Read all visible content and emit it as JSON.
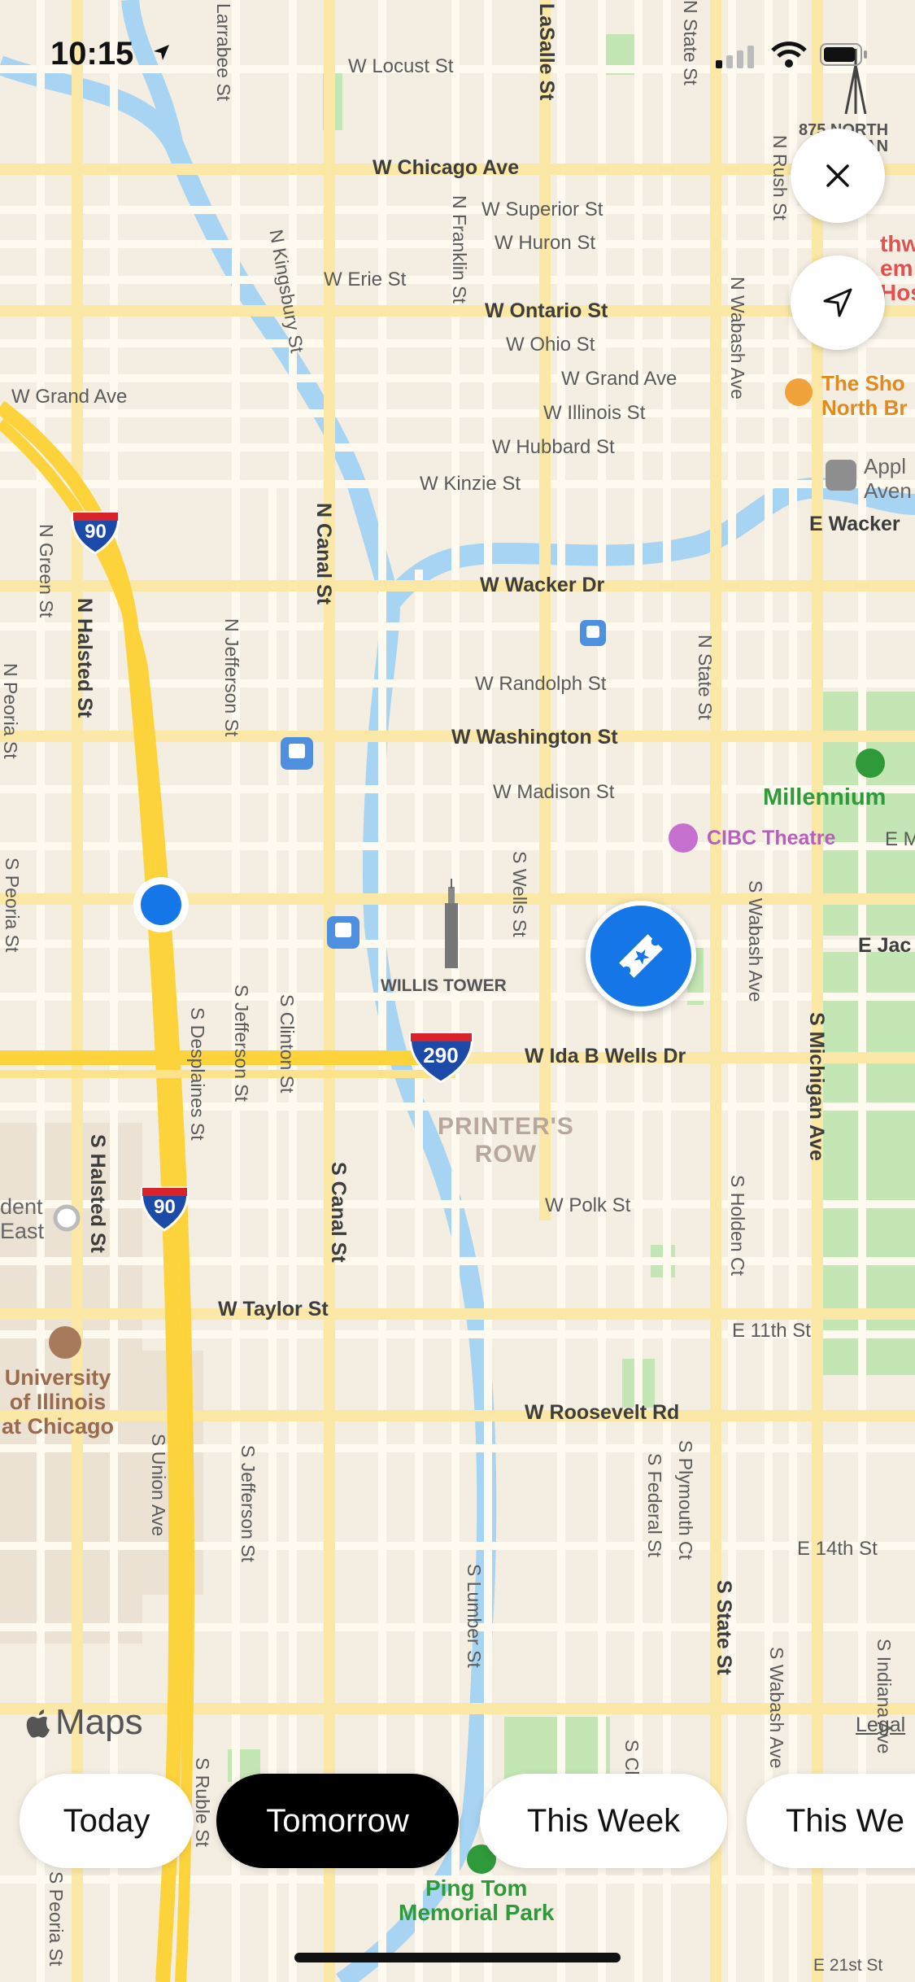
{
  "status_bar": {
    "time": "10:15"
  },
  "streets": {
    "w_locust": "W Locust St",
    "w_chicago": "W Chicago Ave",
    "w_superior": "W Superior St",
    "w_huron": "W Huron St",
    "w_erie": "W Erie St",
    "w_ontario": "W Ontario St",
    "w_ohio": "W Ohio St",
    "w_grand_e": "W Grand Ave",
    "w_grand_w": "W Grand Ave",
    "w_illinois": "W Illinois St",
    "w_hubbard": "W Hubbard St",
    "w_kinzie": "W Kinzie St",
    "e_wacker": "E Wacker",
    "w_wacker": "W Wacker Dr",
    "w_randolph": "W Randolph St",
    "w_washington": "W Washington St",
    "w_madison": "W Madison St",
    "e_jac": "E Jac",
    "w_ida_b_wells": "W Ida B Wells Dr",
    "w_polk": "W Polk St",
    "w_taylor": "W Taylor St",
    "e_11th": "E 11th St",
    "w_roosevelt": "W Roosevelt Rd",
    "e_14th": "E 14th St",
    "e_21st": "E 21st St",
    "e_m": "E M",
    "larrabee": "Larrabee St",
    "lasalle": "LaSalle St",
    "n_state_top": "N State St",
    "n_rush": "N Rush St",
    "n_kingsbury": "N Kingsbury St",
    "n_franklin": "N Franklin St",
    "n_wabash": "N Wabash Ave",
    "n_canal": "N Canal St",
    "n_green": "N Green St",
    "n_halsted": "N Halsted St",
    "n_jefferson": "N Jefferson St",
    "n_peoria": "N Peoria St",
    "n_state": "N State St",
    "s_peoria": "S Peoria St",
    "s_desplaines": "S Desplaines St",
    "s_jefferson": "S Jefferson St",
    "s_clinton": "S Clinton St",
    "s_wells": "S Wells St",
    "s_wabash": "S Wabash Ave",
    "s_michigan": "S Michigan Ave",
    "s_halsted": "S Halsted St",
    "s_canal": "S Canal St",
    "s_holden": "S Holden Ct",
    "s_union": "S Union Ave",
    "s_jefferson2": "S Jefferson St",
    "s_federal": "S Federal St",
    "s_plymouth": "S Plymouth Ct",
    "s_state": "S State St",
    "s_lumber": "S Lumber St",
    "s_wabash2": "S Wabash Ave",
    "s_indiana": "S Indiana Ave",
    "s_ruble": "S Ruble St",
    "s_cla": "S Cla",
    "s_peoria2": "S Peoria St"
  },
  "places": {
    "n875": [
      "875 NORTH",
      "MICHIGAN"
    ],
    "northwestern": [
      "thw",
      "em",
      "Hos"
    ],
    "shops": [
      "The Sho",
      "North Br"
    ],
    "apple": [
      "Appl",
      "Aven"
    ],
    "millennium": "Millennium",
    "cibc": "CIBC Theatre",
    "willis": "WILLIS TOWER",
    "printers_row": [
      "PRINTER'S",
      "ROW"
    ],
    "uic": [
      "University",
      "of Illinois",
      "at Chicago"
    ],
    "student_east": [
      "dent",
      "East"
    ],
    "ping_tom": [
      "Ping Tom",
      "Memorial Park"
    ]
  },
  "highways": {
    "i90_a": "90",
    "i90_b": "90",
    "i290": "290"
  },
  "map_branding": {
    "maps_logo": "Maps",
    "legal": "Legal"
  },
  "filters": [
    {
      "label": "Today",
      "selected": false
    },
    {
      "label": "Tomorrow",
      "selected": true
    },
    {
      "label": "This Week",
      "selected": false
    },
    {
      "label": "This We",
      "selected": false
    }
  ],
  "colors": {
    "land": "#f3ede2",
    "water": "#a6d4f2",
    "park": "#c3e6b4",
    "highway": "#fdd33b",
    "accent": "#1576e8"
  }
}
